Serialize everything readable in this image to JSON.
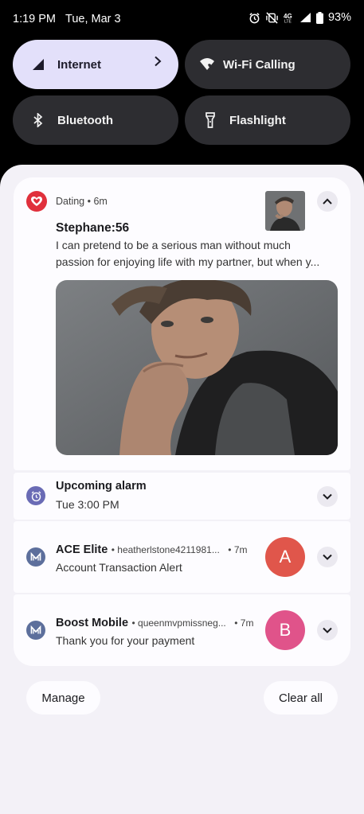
{
  "status_bar": {
    "time": "1:19 PM",
    "date": "Tue, Mar 3",
    "network": "4G",
    "battery": "93%",
    "icons": [
      "alarm-icon",
      "mute-vibrate-icon",
      "4g-lte-icon",
      "signal-icon",
      "battery-icon"
    ]
  },
  "quick_settings": {
    "internet": "Internet",
    "wifi_calling": "Wi-Fi Calling",
    "bluetooth": "Bluetooth",
    "flashlight": "Flashlight"
  },
  "notifications": {
    "dating": {
      "app": "Dating",
      "time": "6m",
      "title": "Stephane:56",
      "line1": "I can pretend to be a serious man without much",
      "line2": "passion for enjoying life with my partner, but when y..."
    },
    "alarm": {
      "title": "Upcoming alarm",
      "body": "Tue 3:00 PM"
    },
    "ace": {
      "app": "ACE Elite",
      "account": "heatherlstone4211981...",
      "time": "7m",
      "body": "Account Transaction Alert",
      "avatar_letter": "A"
    },
    "boost": {
      "app": "Boost Mobile",
      "account": "queenmvpmissneg...",
      "time": "7m",
      "body": "Thank you for your payment",
      "avatar_letter": "B"
    }
  },
  "footer": {
    "manage": "Manage",
    "clear_all": "Clear all"
  },
  "colors": {
    "accent_tile": "#e3e0fa",
    "dating_red": "#e0303c",
    "avatar_a": "#e0564b",
    "avatar_b": "#e0538a",
    "mail_blue": "#5d6f9c",
    "alarm_purple": "#6a6bb5"
  }
}
